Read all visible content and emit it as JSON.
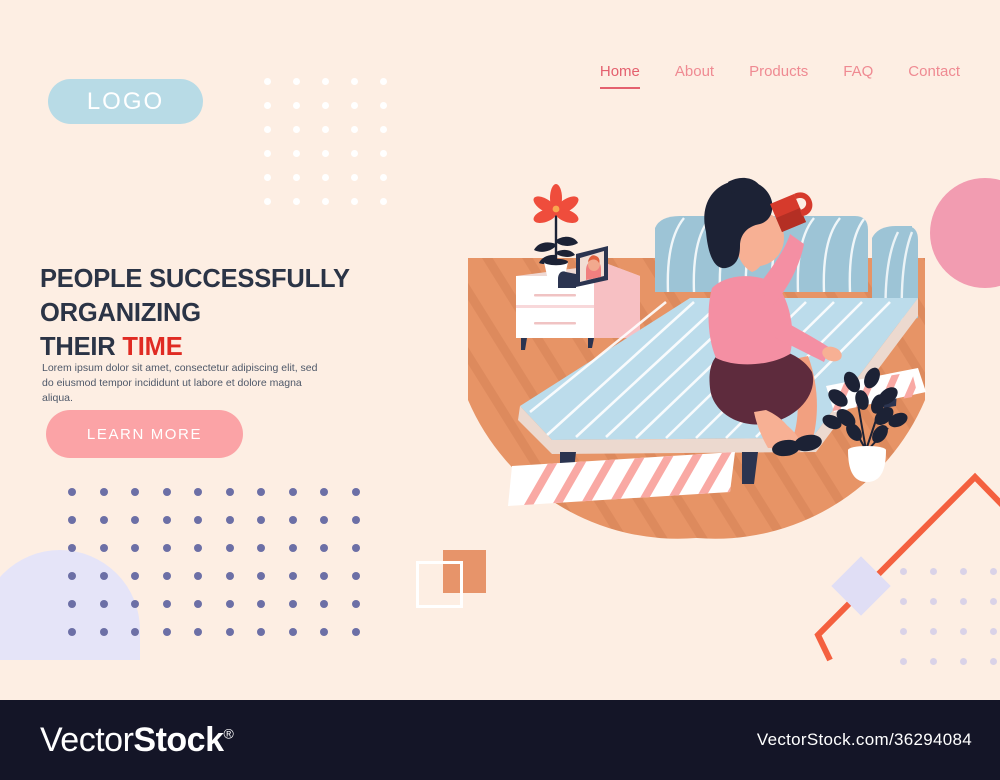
{
  "page": {
    "background_color": "#fdeee3",
    "title": "People successfully organizing their time landing page"
  },
  "header": {
    "logo": {
      "label": "LOGO",
      "pill_color": "#b8dbe6",
      "text_color": "#ffffff"
    },
    "nav": {
      "items": [
        {
          "label": "Home",
          "active": true
        },
        {
          "label": "About",
          "active": false
        },
        {
          "label": "Products",
          "active": false
        },
        {
          "label": "FAQ",
          "active": false
        },
        {
          "label": "Contact",
          "active": false
        }
      ],
      "link_color": "#ef8a92",
      "active_color": "#e4606e"
    }
  },
  "hero": {
    "headline_line1": "PEOPLE SUCCESSFULLY ORGANIZING",
    "headline_line2_prefix": "THEIR ",
    "headline_accent": "TIME",
    "headline_color": "#2b3446",
    "accent_color": "#e02b23",
    "subcopy": "Lorem ipsum dolor sit amet, consectetur adipiscing elit, sed do eiusmod tempor incididunt ut labore et dolore magna aliqua.",
    "cta_label": "LEARN MORE",
    "cta_color": "#fba3a6",
    "cta_text_color": "#ffffff"
  },
  "decorations": {
    "pink_circle_color": "#f29cb1",
    "lavender_semicircle_color": "#e5e4f8",
    "white_dot_color": "#ffffff",
    "purple_dot_color": "#6c6fa6",
    "light_purple_dot_color": "#d9d2e8",
    "square_outline_color": "#ffffff",
    "square_filled_color": "#e7946a",
    "zigzag_color": "#f4603f",
    "diamond_color": "#e0def5"
  },
  "illustration": {
    "scene": "Woman sitting on bed drinking from a mug in a bedroom",
    "floor_color": "#e79466",
    "floor_stripe_color": "#dd8a5d",
    "bed_sheet_color": "#bcdceb",
    "bed_sheet_stripe_color": "#ffffff",
    "headboard_color": "#9dc4d6",
    "bed_frame_color": "#ecd9cf",
    "bed_leg_color": "#2b3450",
    "nightstand_body_color": "#ffffff",
    "nightstand_side_color": "#f7c0c3",
    "nightstand_top_color": "#efd9d4",
    "flower_color": "#ef4d3c",
    "leaf_color": "#1c2235",
    "pot_color": "#ffffff",
    "photo_frame_color": "#2b3450",
    "woman_sweater_color": "#f48fa3",
    "woman_skirt_color": "#5e2b3d",
    "woman_skin_color": "#f7a98b",
    "woman_hair_color": "#1c2235",
    "woman_shoe_color": "#1c2235",
    "mug_color": "#d63a2c",
    "rug_base_color": "#ffffff",
    "rug_stripe_color": "#f9a9a4"
  },
  "footer": {
    "background_color": "#141527",
    "brand_thin": "Vector",
    "brand_bold": "Stock",
    "brand_registered": "®",
    "url": "VectorStock.com/36294084",
    "text_color": "#ffffff"
  }
}
